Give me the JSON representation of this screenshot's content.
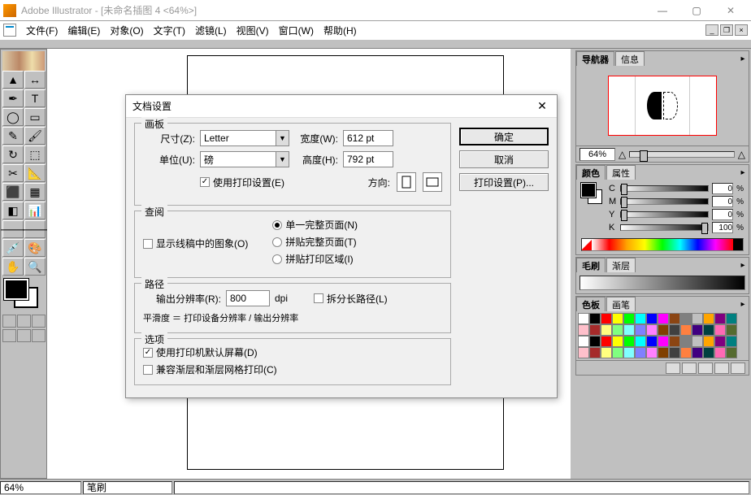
{
  "title": "Adobe Illustrator - [未命名插图 4 <64%>]",
  "menu": [
    "文件(F)",
    "编辑(E)",
    "对象(O)",
    "文字(T)",
    "滤镜(L)",
    "视图(V)",
    "窗口(W)",
    "帮助(H)"
  ],
  "statusbar": {
    "zoom": "64%",
    "tool": "笔刷"
  },
  "panels": {
    "navigator": {
      "tabs": [
        "导航器",
        "信息"
      ],
      "zoom": "64%"
    },
    "color": {
      "tabs": [
        "颜色",
        "属性"
      ],
      "channels": [
        {
          "label": "C",
          "value": "0",
          "unit": "%"
        },
        {
          "label": "M",
          "value": "0",
          "unit": "%"
        },
        {
          "label": "Y",
          "value": "0",
          "unit": "%"
        },
        {
          "label": "K",
          "value": "100",
          "unit": "%"
        }
      ]
    },
    "stroke": {
      "tabs": [
        "毛刷",
        "渐层"
      ]
    },
    "swatches": {
      "tabs": [
        "色板",
        "画笔"
      ]
    },
    "swatch_colors": [
      "#fff",
      "#000",
      "#f00",
      "#ff0",
      "#0f0",
      "#0ff",
      "#00f",
      "#f0f",
      "#8b4513",
      "#808080",
      "#c0c0c0",
      "#ffa500",
      "#800080",
      "#008080",
      "#ffc0cb",
      "#a52a2a",
      "#ffff80",
      "#80ff80",
      "#80ffff",
      "#8080ff",
      "#ff80ff",
      "#804000",
      "#404040",
      "#ff8040",
      "#400080",
      "#004040",
      "#ff69b4",
      "#556b2f"
    ]
  },
  "dialog": {
    "title": "文档设置",
    "buttons": {
      "ok": "确定",
      "cancel": "取消",
      "print": "打印设置(P)..."
    },
    "artboard": {
      "legend": "画板",
      "size_label": "尺寸(Z):",
      "size_value": "Letter",
      "unit_label": "单位(U):",
      "unit_value": "磅",
      "width_label": "宽度(W):",
      "width_value": "612 pt",
      "height_label": "高度(H):",
      "height_value": "792 pt",
      "use_print_checkbox": "使用打印设置(E)",
      "orient_label": "方向:"
    },
    "view": {
      "legend": "查阅",
      "show_images": "显示线稿中的图象(O)",
      "r1": "单一完整页面(N)",
      "r2": "拼贴完整页面(T)",
      "r3": "拼贴打印区域(I)"
    },
    "path": {
      "legend": "路径",
      "res_label": "输出分辨率(R):",
      "res_value": "800",
      "res_unit": "dpi",
      "split_long": "拆分长路径(L)",
      "flatness": "平滑度 ＝ 打印设备分辨率 / 输出分辨率"
    },
    "options": {
      "legend": "选项",
      "o1": "使用打印机默认屏幕(D)",
      "o2": "兼容渐层和渐层网格打印(C)"
    }
  }
}
